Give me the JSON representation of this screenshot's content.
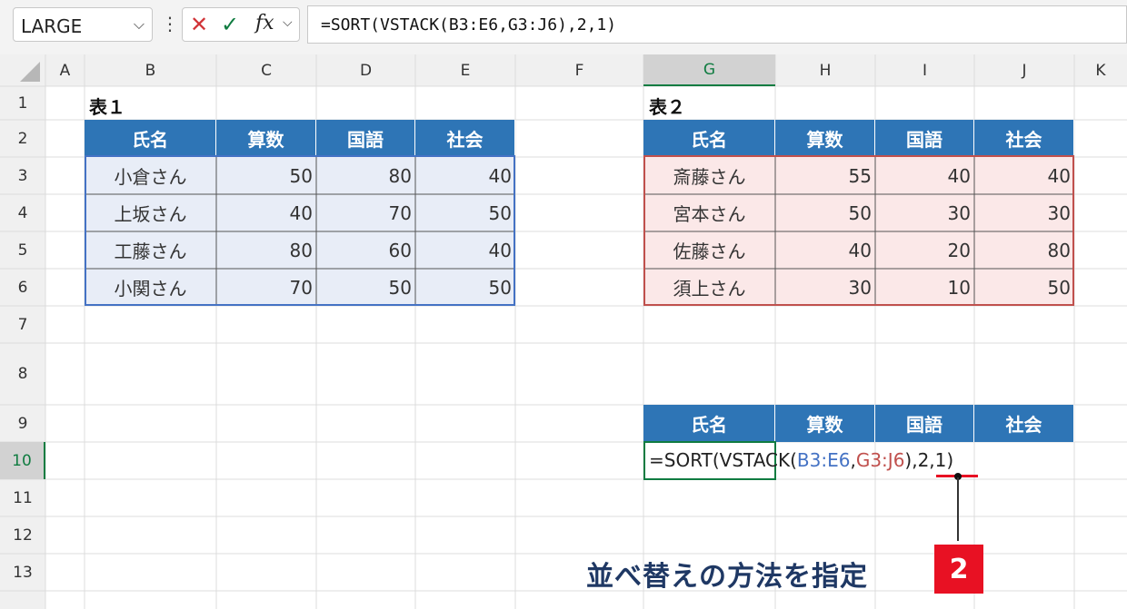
{
  "name_box": {
    "value": "LARGE"
  },
  "formula_bar": {
    "formula": "=SORT(VSTACK(B3:E6,G3:J6),2,1)",
    "fx_label": "fx"
  },
  "columns": [
    "A",
    "B",
    "C",
    "D",
    "E",
    "F",
    "G",
    "H",
    "I",
    "J",
    "K"
  ],
  "rows": [
    "1",
    "2",
    "3",
    "4",
    "5",
    "6",
    "7",
    "8",
    "9",
    "10",
    "11",
    "12",
    "13"
  ],
  "table1": {
    "title": "表１",
    "headers": [
      "氏名",
      "算数",
      "国語",
      "社会"
    ],
    "rows": [
      [
        "小倉さん",
        "50",
        "80",
        "40"
      ],
      [
        "上坂さん",
        "40",
        "70",
        "50"
      ],
      [
        "工藤さん",
        "80",
        "60",
        "40"
      ],
      [
        "小関さん",
        "70",
        "50",
        "50"
      ]
    ]
  },
  "table2": {
    "title": "表２",
    "headers": [
      "氏名",
      "算数",
      "国語",
      "社会"
    ],
    "rows": [
      [
        "斎藤さん",
        "55",
        "40",
        "40"
      ],
      [
        "宮本さん",
        "50",
        "30",
        "30"
      ],
      [
        "佐藤さん",
        "40",
        "20",
        "80"
      ],
      [
        "須上さん",
        "30",
        "10",
        "50"
      ]
    ]
  },
  "result_table": {
    "headers": [
      "氏名",
      "算数",
      "国語",
      "社会"
    ],
    "formula_parts": [
      "=SORT(VSTACK(",
      "B3:E6",
      ",",
      "G3:J6",
      "),2,1)"
    ]
  },
  "annotation": {
    "text": "並べ替えの方法を指定",
    "badge": "2"
  },
  "colors": {
    "header_blue": "#2e75b6",
    "table1_fill": "#e8edf7",
    "table2_fill": "#fbe8e8",
    "ref_blue": "#4472c4",
    "ref_red": "#c0504d",
    "accent_red": "#e81123",
    "excel_green": "#107c41"
  }
}
